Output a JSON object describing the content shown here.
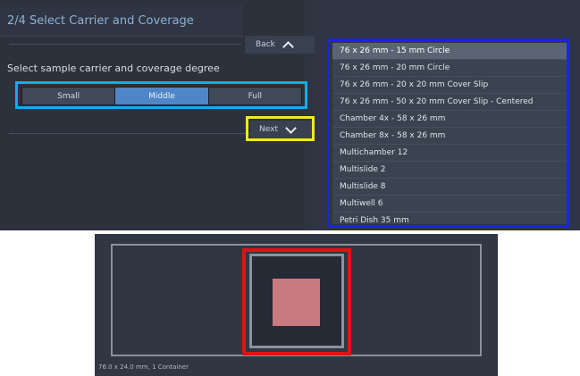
{
  "panel": {
    "step_title": "2/4  Select Carrier and Coverage",
    "back_label": "Back",
    "prompt": "Select sample carrier and coverage degree",
    "coverage_options": [
      "Small",
      "Middle",
      "Full"
    ],
    "selected_coverage": "Middle",
    "next_label": "Next"
  },
  "carrier_list": {
    "selected_item": "76 x 26 mm - 15 mm Circle",
    "items": [
      "76 x 26 mm - 15 mm Circle",
      "76 x 26 mm - 20 mm Circle",
      "76 x 26 mm - 20 x 20 mm Cover Slip",
      "76 x 26 mm - 50 x 20 mm Cover Slip - Centered",
      "Chamber 4x - 58 x 26 mm",
      "Chamber 8x - 58 x 26 mm",
      "Multichamber 12",
      "Multislide 2",
      "Multislide 8",
      "Multiwell 6",
      "Petri Dish 35 mm"
    ]
  },
  "preview": {
    "caption": "76.0 x 24.0 mm, 1 Container"
  },
  "colors": {
    "highlight_blue": "#1a24e8",
    "highlight_cyan": "#12aee8",
    "highlight_yellow": "#f2ea16",
    "highlight_red": "#e11212",
    "selected_segment": "#4f86c8"
  }
}
